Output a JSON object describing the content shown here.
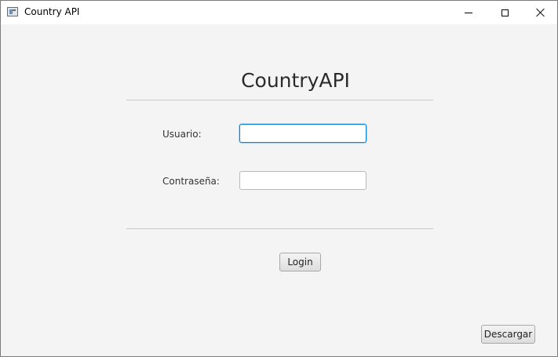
{
  "window": {
    "title": "Country API",
    "controls": [
      "minimize-icon",
      "maximize-icon",
      "close-icon"
    ]
  },
  "form": {
    "heading": "CountryAPI",
    "username": {
      "label": "Usuario:",
      "value": "",
      "focused": true
    },
    "password": {
      "label": "Contraseña:",
      "value": ""
    },
    "login_label": "Login"
  },
  "footer": {
    "download_label": "Descargar"
  },
  "colors": {
    "background": "#f4f4f4",
    "focus_border": "#0a84d9",
    "separator": "#c8c8c8"
  }
}
